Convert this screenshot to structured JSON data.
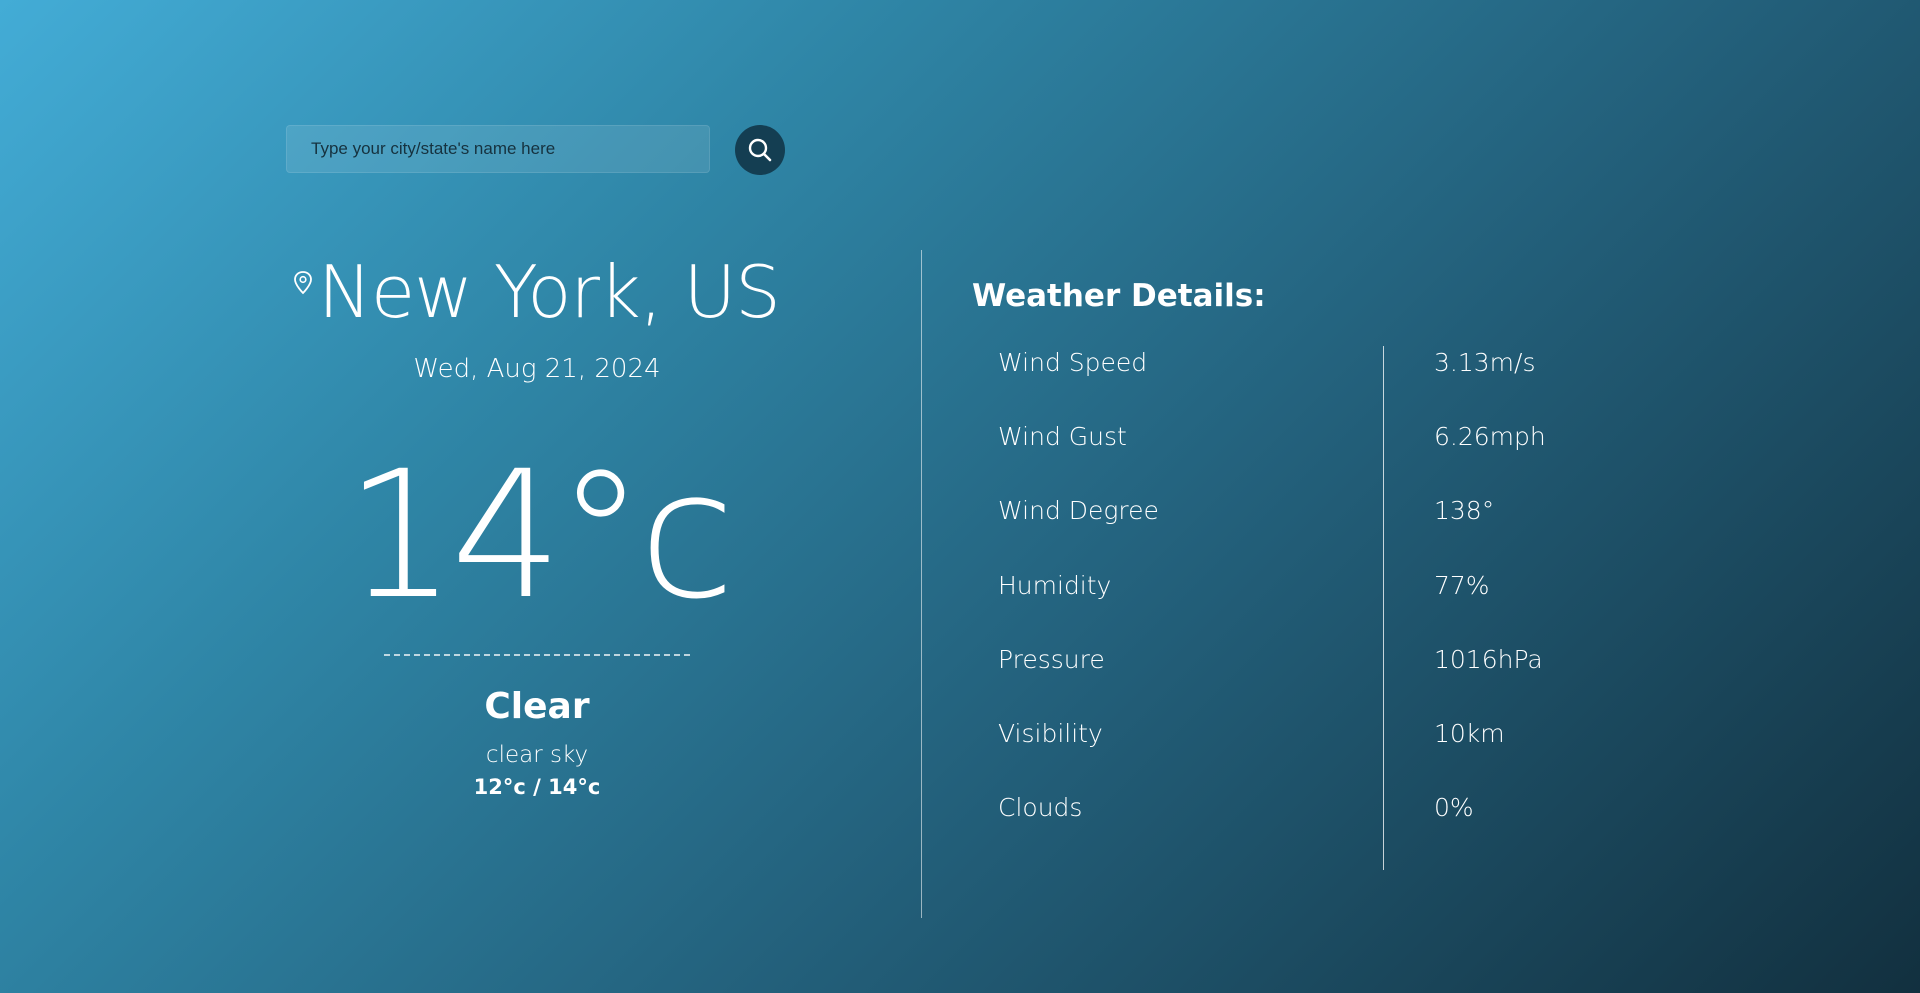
{
  "search": {
    "placeholder": "Type your city/state's name here"
  },
  "location": {
    "city": "New York, US",
    "date": "Wed, Aug 21, 2024"
  },
  "current": {
    "temperature": "14°c",
    "condition": "Clear",
    "description": "clear sky",
    "range": "12°c / 14°c"
  },
  "details": {
    "title": "Weather Details:",
    "rows": [
      {
        "label": "Wind Speed",
        "value": "3.13m/s"
      },
      {
        "label": "Wind Gust",
        "value": "6.26mph"
      },
      {
        "label": "Wind Degree",
        "value": "138°"
      },
      {
        "label": "Humidity",
        "value": "77%"
      },
      {
        "label": "Pressure",
        "value": "1016hPa"
      },
      {
        "label": "Visibility",
        "value": "10km"
      },
      {
        "label": "Clouds",
        "value": "0%"
      }
    ]
  },
  "icons": {
    "search": "search-icon",
    "location": "location-pin-icon"
  },
  "colors": {
    "gradient_start": "#43acd6",
    "gradient_end": "#12303f",
    "search_button": "#143e52",
    "text": "#ffffff"
  }
}
